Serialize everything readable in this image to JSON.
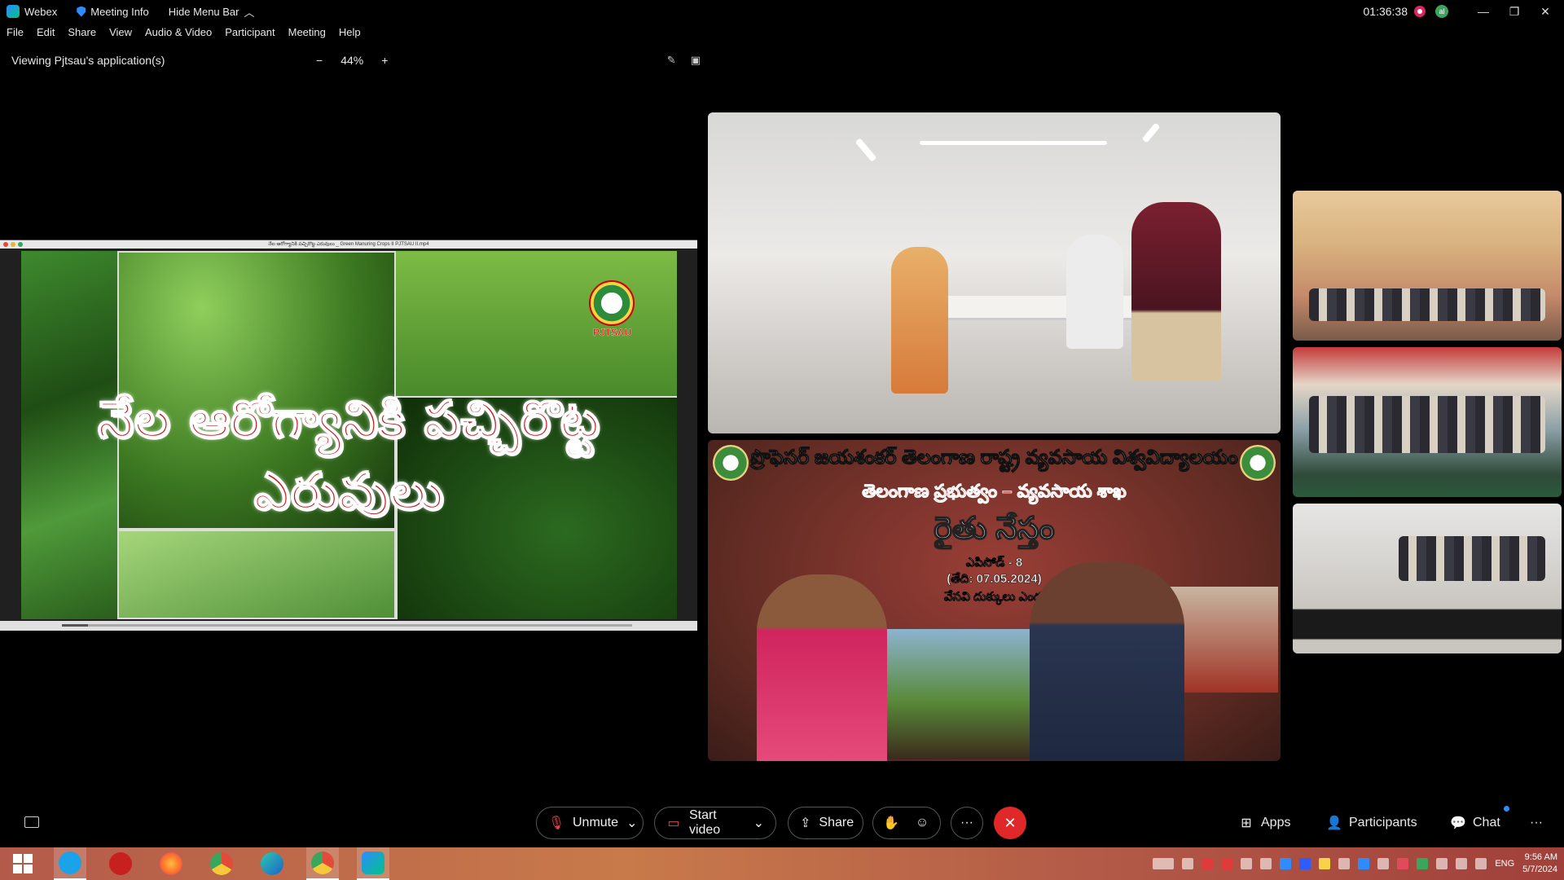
{
  "titlebar": {
    "app_name": "Webex",
    "meeting_info": "Meeting Info",
    "hide_menu": "Hide Menu Bar",
    "timer": "01:36:38",
    "avatar_initial": "al"
  },
  "menu": {
    "items": [
      "File",
      "Edit",
      "Share",
      "View",
      "Audio & Video",
      "Participant",
      "Meeting",
      "Help"
    ]
  },
  "viewbar": {
    "title": "Viewing Pjtsau's application(s)",
    "zoom": "44%",
    "zoom_minus": "−",
    "zoom_plus": "+"
  },
  "shared": {
    "window_title": "నేల ఆరోగ్యానికి పచ్చిరొట్ట ఎరువులు _ Green Manuring Crops II PJTSAU II.mp4",
    "slide_title": "నేల ఆరోగ్యానికి పచ్చిరొట్ట ఎరువులు",
    "logo_label": "PJTSAU"
  },
  "banner": {
    "line1": "ప్రొఫెసర్ జయశంకర్ తెలంగాణ రాష్ట్ర వ్యవసాయ విశ్వవిద్యాలయం",
    "line2": "తెలంగాణ ప్రభుత్వం – వ్యవసాయ శాఖ",
    "line3": "రైతు నేస్తం",
    "line4": "ఎపిసోడ్ - 8",
    "line5": "(తేది: 07.05.2024)",
    "line6": "వేసవి దుక్కులు ఎందుకు చేసుకోవాలి -"
  },
  "controls": {
    "unmute": "Unmute",
    "start_video": "Start video",
    "share": "Share",
    "more": "···",
    "apps": "Apps",
    "participants": "Participants",
    "chat": "Chat",
    "overflow": "···"
  },
  "taskbar": {
    "lang": "ENG",
    "time": "9:56 AM",
    "date": "5/7/2024"
  },
  "colors": {
    "end_call": "#e02828",
    "accent": "#2d8cff",
    "record": "#e0245e"
  }
}
